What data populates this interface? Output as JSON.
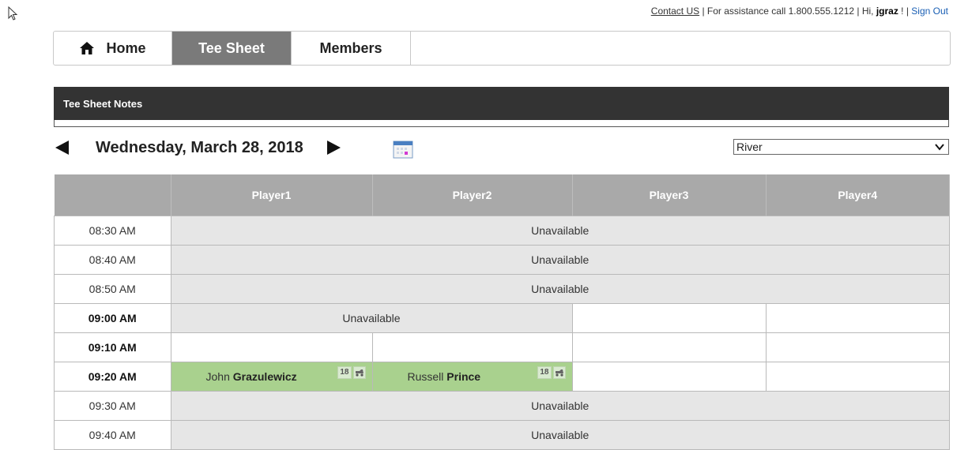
{
  "topbar": {
    "contact_label": "Contact US",
    "assist_text": " | For assistance call 1.800.555.1212 | Hi, ",
    "username": "jgraz",
    "after_user": " ! | ",
    "signout_label": "Sign Out"
  },
  "nav": {
    "home_label": "Home",
    "teesheet_label": "Tee Sheet",
    "members_label": "Members"
  },
  "notes": {
    "title": "Tee Sheet Notes"
  },
  "date": {
    "label": "Wednesday, March 28, 2018"
  },
  "course": {
    "selected": "River"
  },
  "table": {
    "headers": [
      "",
      "Player1",
      "Player2",
      "Player3",
      "Player4"
    ],
    "rows": [
      {
        "time": "08:30 AM",
        "bold": false,
        "type": "unavail",
        "text": "Unavailable"
      },
      {
        "time": "08:40 AM",
        "bold": false,
        "type": "unavail",
        "text": "Unavailable"
      },
      {
        "time": "08:50 AM",
        "bold": false,
        "type": "unavail",
        "text": "Unavailable"
      },
      {
        "time": "09:00 AM",
        "bold": true,
        "type": "partial",
        "text": "Unavailable"
      },
      {
        "time": "09:10 AM",
        "bold": true,
        "type": "open"
      },
      {
        "time": "09:20 AM",
        "bold": true,
        "type": "booked",
        "players": [
          {
            "first": "John",
            "last": "Grazulewicz",
            "holes": "18"
          },
          {
            "first": "Russell",
            "last": "Prince",
            "holes": "18"
          }
        ]
      },
      {
        "time": "09:30 AM",
        "bold": false,
        "type": "unavail",
        "text": "Unavailable"
      },
      {
        "time": "09:40 AM",
        "bold": false,
        "type": "unavail",
        "text": "Unavailable"
      }
    ]
  },
  "icons": {
    "home": "home-icon",
    "calendar": "calendar-icon",
    "cart": "golf-cart-icon",
    "cursor": "mouse-cursor-icon"
  }
}
